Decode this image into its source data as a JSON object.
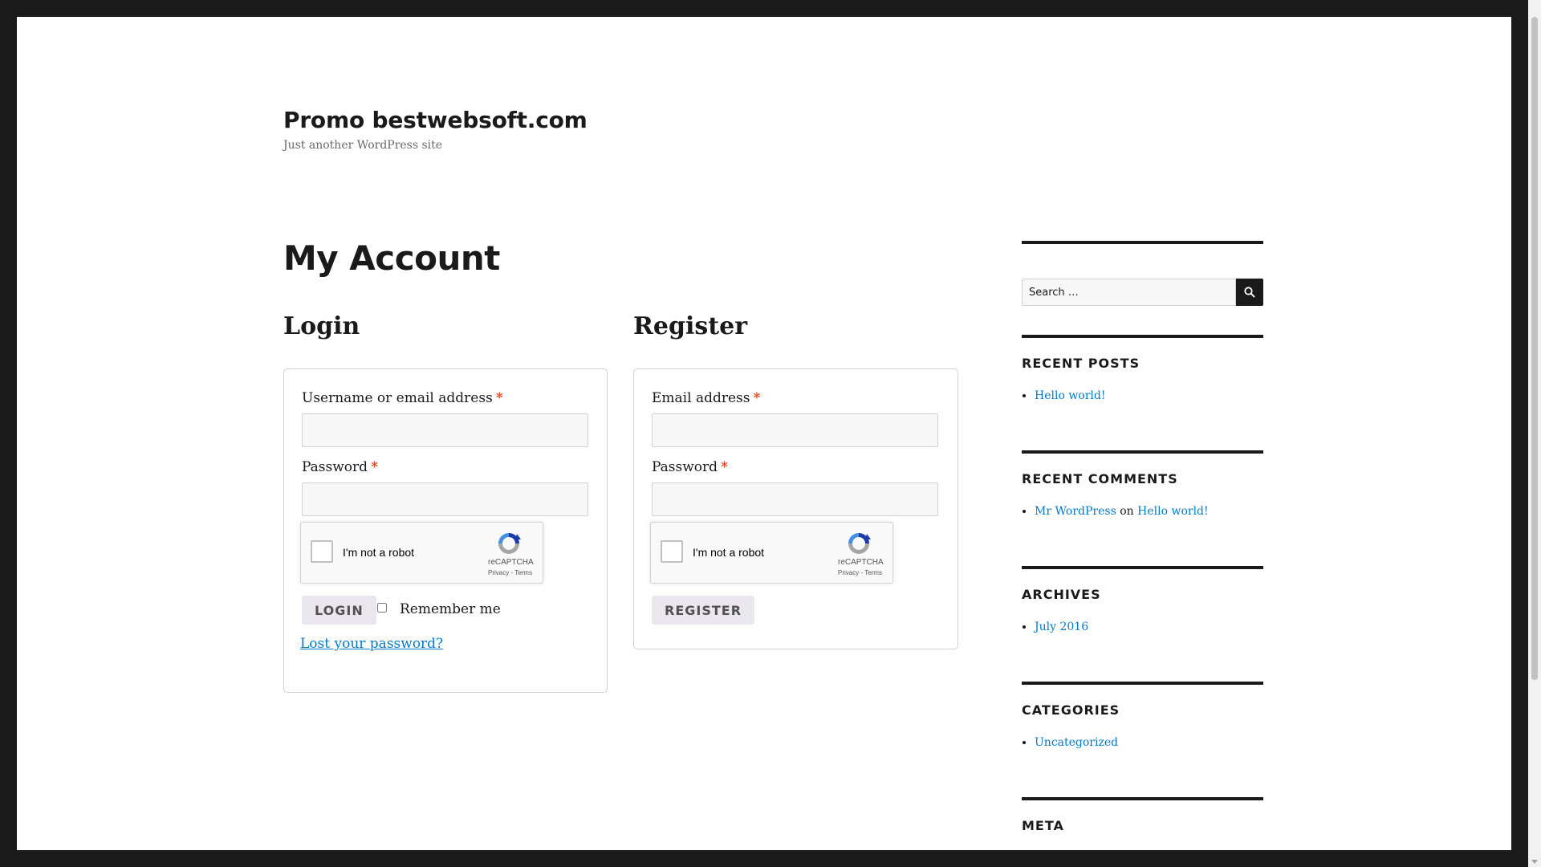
{
  "site": {
    "title": "Promo bestwebsoft.com",
    "description": "Just another WordPress site"
  },
  "page": {
    "title": "My Account"
  },
  "login": {
    "heading": "Login",
    "username_label": "Username or email address",
    "password_label": "Password",
    "required_mark": "*",
    "button_label": "LOGIN",
    "remember_label": "Remember me",
    "lost_password": "Lost your password?"
  },
  "register": {
    "heading": "Register",
    "email_label": "Email address",
    "password_label": "Password",
    "required_mark": "*",
    "button_label": "REGISTER"
  },
  "recaptcha": {
    "label": "I'm not a robot",
    "brand": "reCAPTCHA",
    "terms": "Privacy - Terms"
  },
  "sidebar": {
    "search": {
      "placeholder": "Search …",
      "icon": "search-icon"
    },
    "recent_posts": {
      "title": "RECENT POSTS",
      "items": [
        "Hello world!"
      ]
    },
    "recent_comments": {
      "title": "RECENT COMMENTS",
      "items": [
        {
          "author": "Mr WordPress",
          "connector": "on",
          "post": "Hello world!"
        }
      ]
    },
    "archives": {
      "title": "ARCHIVES",
      "items": [
        "July 2016"
      ]
    },
    "categories": {
      "title": "CATEGORIES",
      "items": [
        "Uncategorized"
      ]
    },
    "meta": {
      "title": "META"
    }
  },
  "colors": {
    "link": "#007acc",
    "required": "#e2401c",
    "text": "#1a1a1a",
    "frame": "#1a1a1a"
  }
}
